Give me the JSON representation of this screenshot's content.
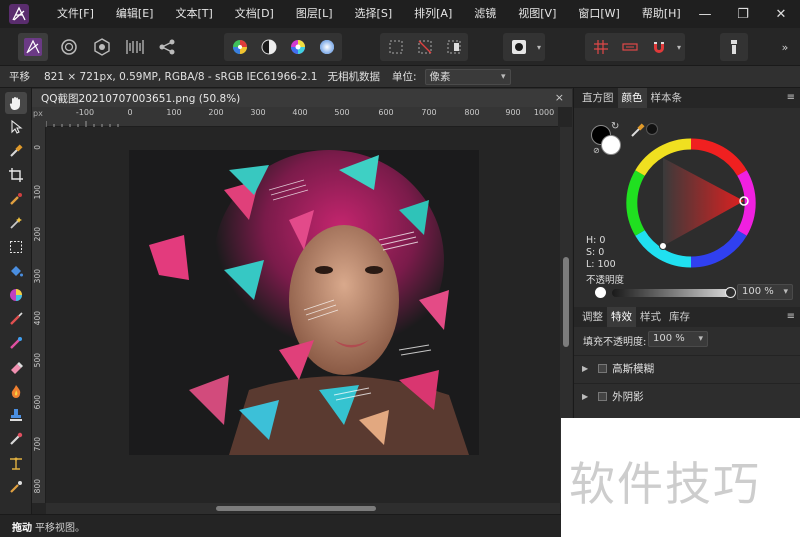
{
  "menu": {
    "items": [
      "文件[F]",
      "编辑[E]",
      "文本[T]",
      "文档[D]",
      "图层[L]",
      "选择[S]",
      "排列[A]",
      "滤镜",
      "视图[V]",
      "窗口[W]",
      "帮助[H]"
    ],
    "window_controls": [
      "—",
      "❐",
      "✕"
    ]
  },
  "context": {
    "tool_name": "平移",
    "doc_info": "821 × 721px, 0.59MP, RGBA/8 - sRGB IEC61966-2.1",
    "camera": "无相机数据",
    "units_label": "单位:",
    "units_value": "像素"
  },
  "document": {
    "tab_title": "QQ截图20210707003651.png (50.8%)",
    "close": "×",
    "ruler_unit": "px",
    "ruler_h_labels": [
      "-100",
      "0",
      "100",
      "200",
      "300",
      "400",
      "500",
      "600",
      "700",
      "800",
      "900",
      "1000"
    ],
    "ruler_v_labels": [
      "0",
      "100",
      "200",
      "300",
      "400",
      "500",
      "600",
      "700",
      "800"
    ]
  },
  "panels": {
    "top_tabs": [
      "直方图",
      "颜色",
      "样本条"
    ],
    "top_active_tab": "颜色",
    "hsl": {
      "h": "H: 0",
      "s": "S: 0",
      "l": "L: 100"
    },
    "opacity_label": "不透明度",
    "opacity_value": "100 %",
    "bottom_tabs": [
      "调整",
      "特效",
      "样式",
      "库存"
    ],
    "bottom_active_tab": "特效",
    "fill_opacity_label": "填充不透明度:",
    "fill_opacity_value": "100 %",
    "effects": [
      "高斯模糊",
      "外阴影"
    ],
    "menu_glyph": "≡"
  },
  "colors": {
    "primary_fill": "#000000",
    "secondary_fill": "#ffffff",
    "accent": "#3b7ed8"
  },
  "status": {
    "tool": "拖动",
    "hint": "平移视图。"
  },
  "watermark": {
    "text": "软件技巧"
  }
}
